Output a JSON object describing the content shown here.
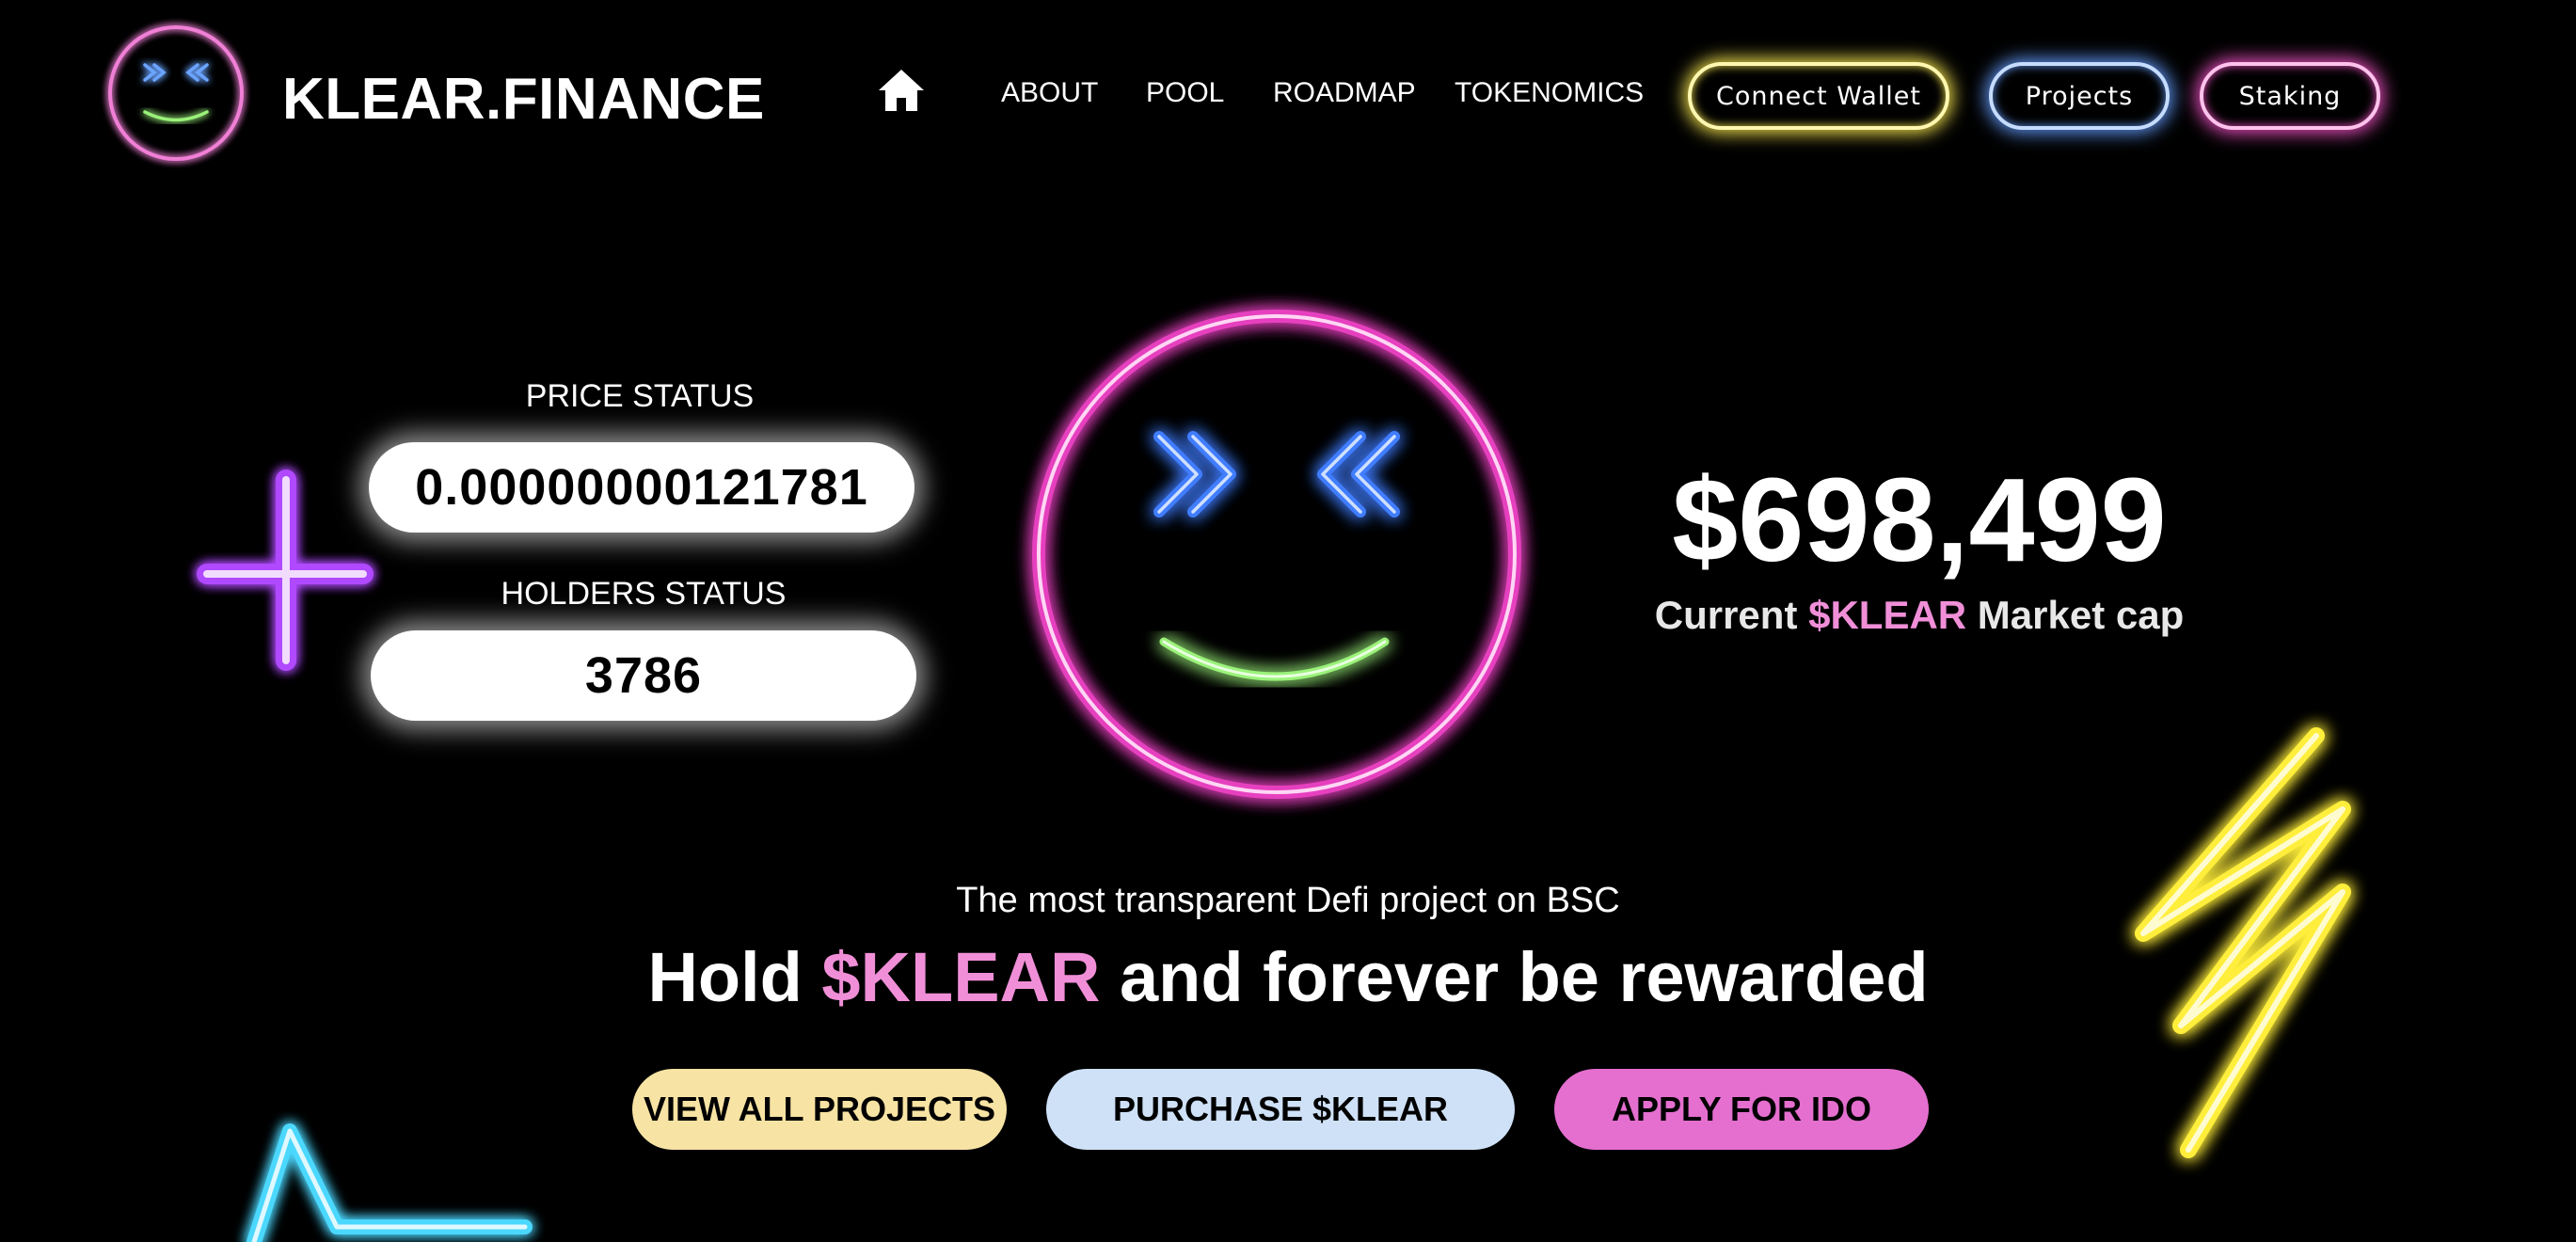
{
  "header": {
    "brand": "KLEAR.FINANCE",
    "nav": [
      "ABOUT",
      "POOL",
      "ROADMAP",
      "TOKENOMICS"
    ],
    "connect_wallet": "Connect Wallet",
    "projects": "Projects",
    "staking": "Staking",
    "home_icon": "home-icon"
  },
  "stats": {
    "price_label": "PRICE STATUS",
    "price_value": "0.00000000121781",
    "holders_label": "HOLDERS STATUS",
    "holders_value": "3786"
  },
  "market_cap": {
    "value": "$698,499",
    "label_prefix": "Current ",
    "label_token": "$KLEAR",
    "label_suffix": " Market cap"
  },
  "hero": {
    "tagline": "The most transparent Defi project on BSC",
    "headline_prefix": "Hold ",
    "headline_token": "$KLEAR",
    "headline_suffix": " and forever be rewarded"
  },
  "cta": {
    "view_projects": "VIEW ALL PROJECTS",
    "purchase": "PURCHASE $KLEAR",
    "apply_ido": "APPLY FOR IDO"
  },
  "colors": {
    "background": "#000000",
    "neon_pink": "#e63fbf",
    "neon_blue": "#3f7dff",
    "neon_green": "#9bf27a",
    "neon_yellow": "#ffee3a",
    "neon_purple": "#b048ff",
    "neon_cyan": "#4cd8ff",
    "cta_yellow": "#f7e3a3",
    "cta_blue": "#cfe1f7",
    "cta_pink": "#e46fcf"
  },
  "icons": [
    "smiley-logo-icon",
    "home-icon",
    "neon-smiley-icon",
    "neon-plus-icon",
    "neon-lightning-icon",
    "neon-star-icon"
  ]
}
